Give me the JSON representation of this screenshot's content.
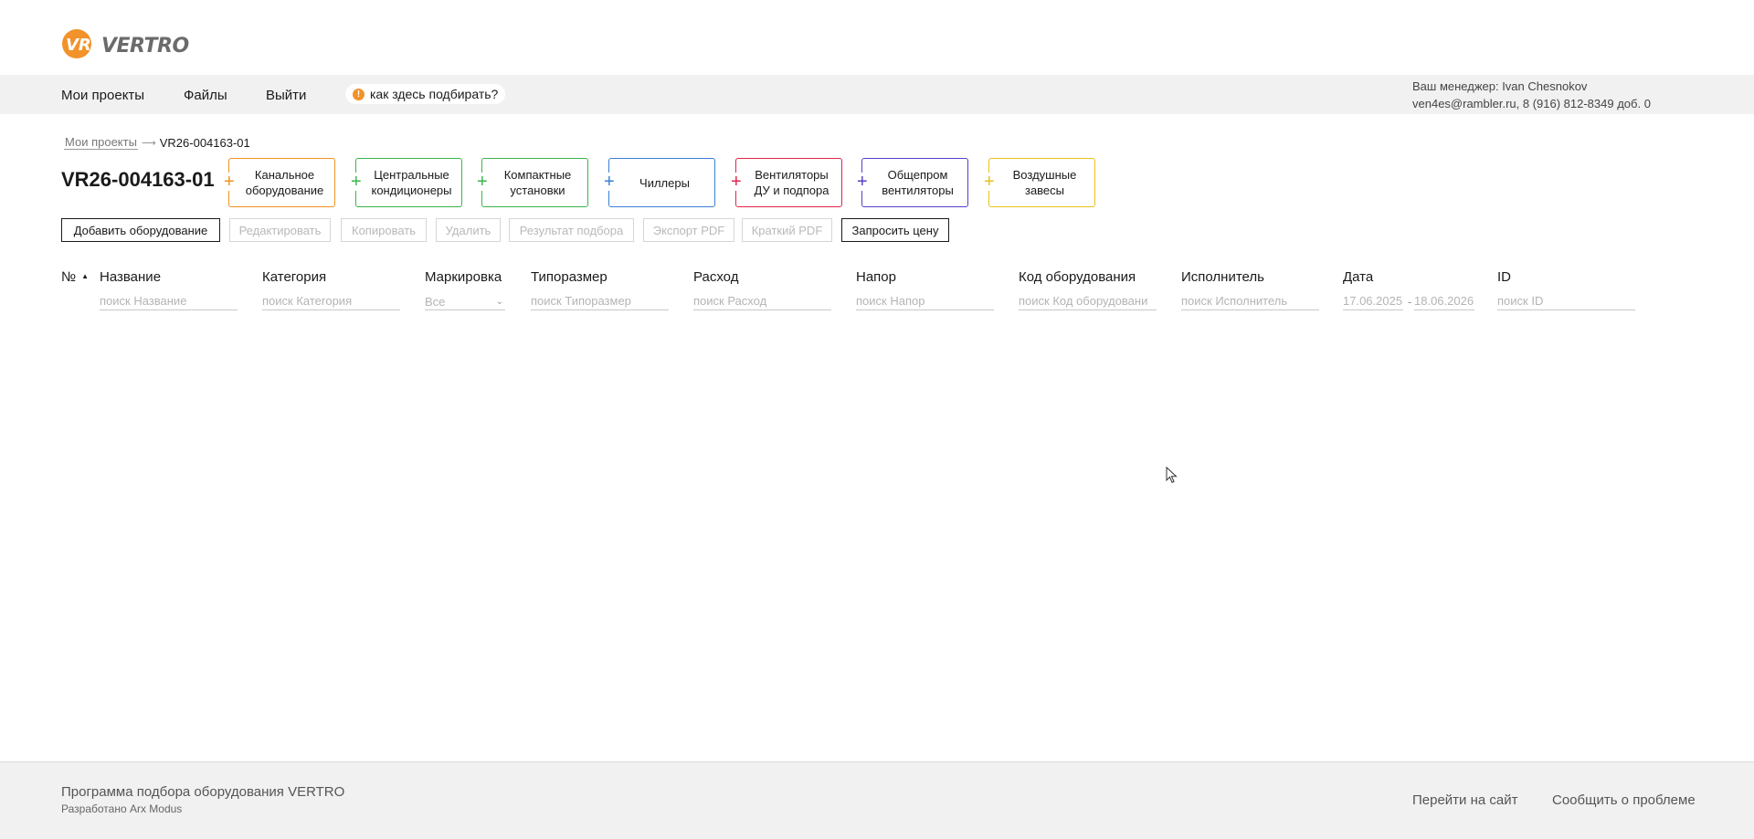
{
  "header": {
    "logo_text": "VERTRO",
    "logo_icon": "vr-logo-icon",
    "accent_color": "#f2922a"
  },
  "nav": {
    "items": [
      {
        "label": "Мои проекты"
      },
      {
        "label": "Файлы"
      },
      {
        "label": "Выйти"
      }
    ],
    "help_label": "как здесь подбирать?",
    "help_icon": "info-icon",
    "manager_line1": "Ваш менеджер: Ivan Chesnokov",
    "manager_line2": "ven4es@rambler.ru, 8 (916) 812-8349 доб. 0"
  },
  "breadcrumb": {
    "parent": "Мои проекты",
    "current": "VR26-004163-01"
  },
  "project": {
    "title": "VR26-004163-01"
  },
  "categories": [
    {
      "label": "Канальное оборудование",
      "color": "#f0921e"
    },
    {
      "label": "Центральные кондиционеры",
      "color": "#3bb54a"
    },
    {
      "label": "Компактные установки",
      "color": "#3bb54a"
    },
    {
      "label": "Чиллеры",
      "color": "#3a7fd5"
    },
    {
      "label": "Вентиляторы ДУ и подпора",
      "color": "#e0254a"
    },
    {
      "label": "Общепром вентиляторы",
      "color": "#5a3fc8"
    },
    {
      "label": "Воздушные завесы",
      "color": "#e8c21a"
    }
  ],
  "actions": [
    {
      "label": "Добавить оборудование",
      "enabled": true
    },
    {
      "label": "Редактировать",
      "enabled": false
    },
    {
      "label": "Копировать",
      "enabled": false
    },
    {
      "label": "Удалить",
      "enabled": false
    },
    {
      "label": "Результат подбора",
      "enabled": false
    },
    {
      "label": "Экспорт PDF",
      "enabled": false
    },
    {
      "label": "Краткий PDF",
      "enabled": false
    },
    {
      "label": "Запросить цену",
      "enabled": true
    }
  ],
  "table": {
    "columns": [
      {
        "label": "№",
        "sorted": "asc"
      },
      {
        "label": "Название",
        "filter": "поиск Название"
      },
      {
        "label": "Категория",
        "filter": "поиск Категория"
      },
      {
        "label": "Маркировка",
        "filter": "Все"
      },
      {
        "label": "Типоразмер",
        "filter": "поиск Типоразмер"
      },
      {
        "label": "Расход",
        "filter": "поиск Расход"
      },
      {
        "label": "Напор",
        "filter": "поиск Напор"
      },
      {
        "label": "Код оборудования",
        "filter": "поиск Код оборудовани"
      },
      {
        "label": "Исполнитель",
        "filter": "поиск Исполнитель"
      },
      {
        "label": "Дата",
        "date_from": "17.06.2025",
        "date_sep": "-",
        "date_to": "18.06.2026"
      },
      {
        "label": "ID",
        "filter": "поиск ID"
      }
    ],
    "rows": []
  },
  "footer": {
    "title": "Программа подбора оборудования VERTRO",
    "subtitle": "Разработано Arx Modus",
    "link_site": "Перейти на сайт",
    "link_report": "Сообщить о проблеме"
  }
}
